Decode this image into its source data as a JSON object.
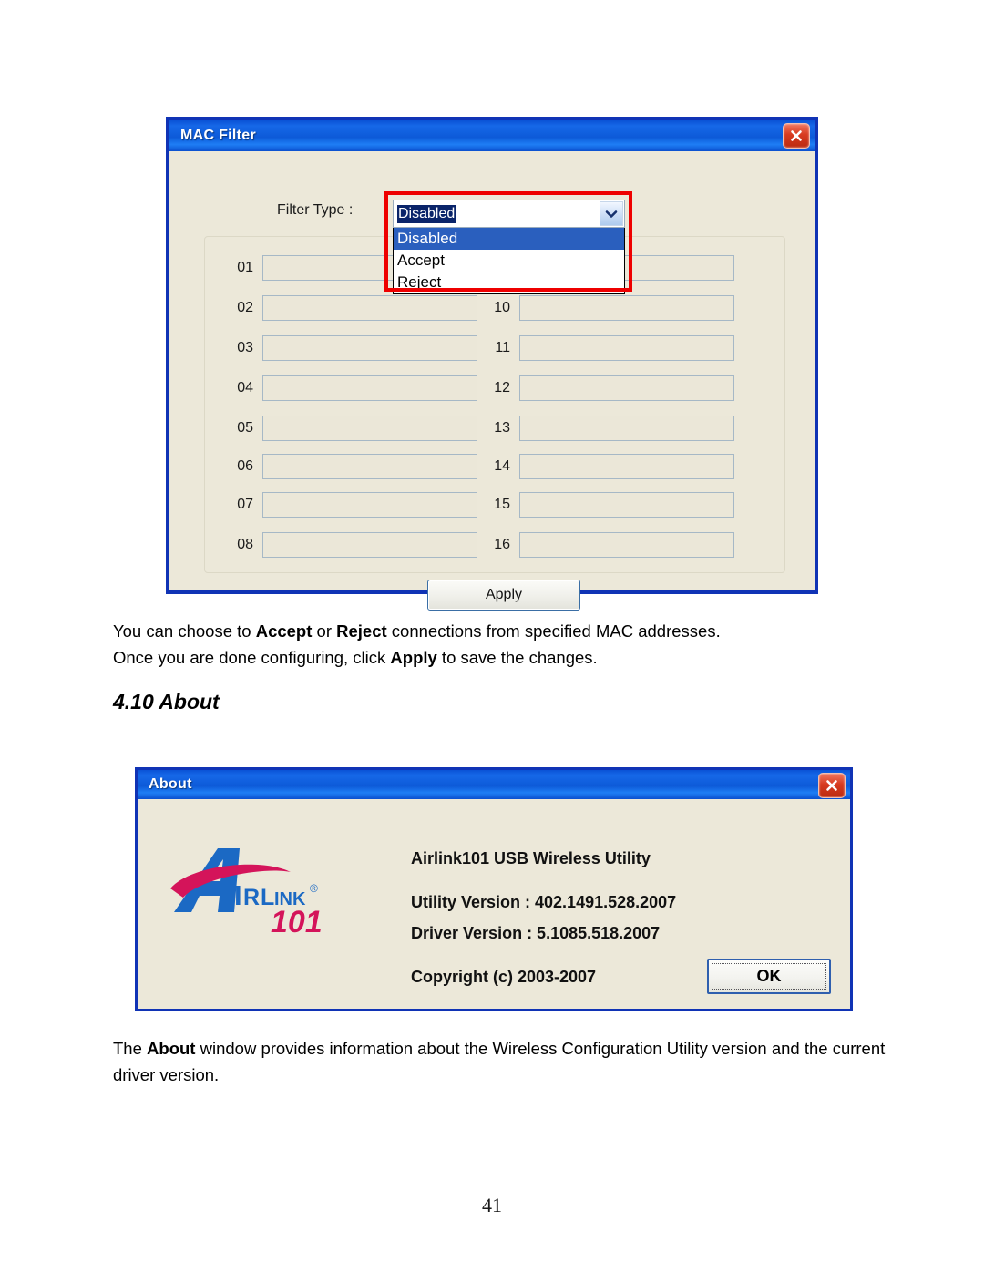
{
  "page": {
    "number": "41"
  },
  "mac_filter_dialog": {
    "title": "MAC Filter",
    "close_label": "Close",
    "filter_type_label": "Filter Type :",
    "combo": {
      "selected": "Disabled",
      "options": [
        "Disabled",
        "Accept",
        "Reject"
      ]
    },
    "rows_left": [
      {
        "num": "01",
        "value": ""
      },
      {
        "num": "02",
        "value": ""
      },
      {
        "num": "03",
        "value": ""
      },
      {
        "num": "04",
        "value": ""
      },
      {
        "num": "05",
        "value": ""
      },
      {
        "num": "06",
        "value": ""
      },
      {
        "num": "07",
        "value": ""
      },
      {
        "num": "08",
        "value": ""
      }
    ],
    "rows_right": [
      {
        "num": "",
        "value": ""
      },
      {
        "num": "10",
        "value": ""
      },
      {
        "num": "11",
        "value": ""
      },
      {
        "num": "12",
        "value": ""
      },
      {
        "num": "13",
        "value": ""
      },
      {
        "num": "14",
        "value": ""
      },
      {
        "num": "15",
        "value": ""
      },
      {
        "num": "16",
        "value": ""
      }
    ],
    "apply_label": "Apply",
    "annotation_color": "#ee0000"
  },
  "paragraph_1": {
    "line1_pre": "You can choose to ",
    "line1_b1": "Accept",
    "line1_mid": " or ",
    "line1_b2": "Reject",
    "line1_post": " connections from specified MAC addresses.",
    "line2_pre": "Once you are done configuring, click ",
    "line2_b1": "Apply",
    "line2_post": " to save the changes."
  },
  "section": {
    "heading": "4.10 About"
  },
  "about_dialog": {
    "title": "About",
    "close_label": "Close",
    "logo_text_main": "AIRLINK",
    "logo_text_sub": "101",
    "logo_blue": "#1b69c4",
    "logo_red": "#d4145a",
    "product": "Airlink101 USB Wireless Utility",
    "utility_version": "Utility Version : 402.1491.528.2007",
    "driver_version": "Driver Version : 5.1085.518.2007",
    "copyright": "Copyright (c) 2003-2007",
    "ok_label": "OK"
  },
  "paragraph_2": {
    "pre": "The ",
    "b1": "About",
    "post": " window provides information about the Wireless Configuration Utility version and the current driver version."
  }
}
